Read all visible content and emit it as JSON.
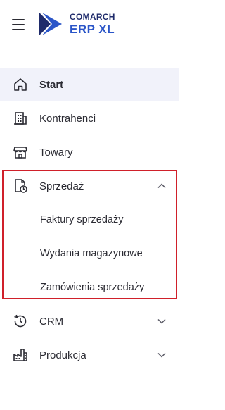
{
  "header": {
    "logo_top": "COMARCH",
    "logo_bottom": "ERP XL",
    "hamburger_icon": "menu-icon"
  },
  "nav": {
    "items": [
      {
        "label": "Start",
        "icon": "home-icon",
        "active": true
      },
      {
        "label": "Kontrahenci",
        "icon": "building-icon"
      },
      {
        "label": "Towary",
        "icon": "store-icon"
      },
      {
        "label": "Sprzedaż",
        "icon": "sales-document-icon",
        "expanded": true,
        "children": [
          {
            "label": "Faktury sprzedaży"
          },
          {
            "label": "Wydania magazynowe"
          },
          {
            "label": "Zamówienia sprzedaży"
          }
        ]
      },
      {
        "label": "CRM",
        "icon": "history-icon",
        "expanded": false
      },
      {
        "label": "Produkcja",
        "icon": "factory-icon",
        "expanded": false
      }
    ]
  },
  "colors": {
    "active_bg": "#f1f2fa",
    "highlight_border": "#d0202a",
    "logo_dark": "#1f2b6b",
    "logo_blue": "#2a55c8"
  }
}
